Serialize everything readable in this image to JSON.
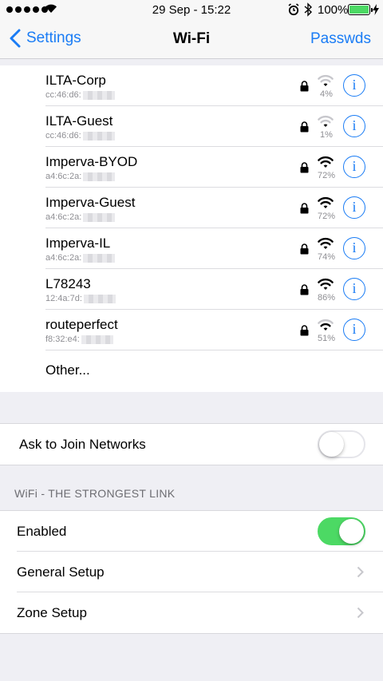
{
  "status_bar": {
    "time": "29 Sep - 15:22",
    "battery_percent": "100%",
    "battery_level": 1.0,
    "icons": [
      "signal-dots",
      "wifi-icon",
      "alarm-icon",
      "bluetooth-icon",
      "battery-icon",
      "charging-icon"
    ]
  },
  "nav": {
    "back_label": "Settings",
    "title": "Wi-Fi",
    "right_label": "Passwds"
  },
  "networks": [
    {
      "name": "ILTA-Corp",
      "mac": "cc:46:d6:",
      "signal": "4%",
      "bars": 1
    },
    {
      "name": "ILTA-Guest",
      "mac": "cc:46:d6:",
      "signal": "1%",
      "bars": 1
    },
    {
      "name": "Imperva-BYOD",
      "mac": "a4:6c:2a:",
      "signal": "72%",
      "bars": 3
    },
    {
      "name": "Imperva-Guest",
      "mac": "a4:6c:2a:",
      "signal": "72%",
      "bars": 3
    },
    {
      "name": "Imperva-IL",
      "mac": "a4:6c:2a:",
      "signal": "74%",
      "bars": 3
    },
    {
      "name": "L78243",
      "mac": "12:4a:7d:",
      "signal": "86%",
      "bars": 3
    },
    {
      "name": "routeperfect",
      "mac": "f8:32:e4:",
      "signal": "51%",
      "bars": 2
    }
  ],
  "other_label": "Other...",
  "ask_to_join": {
    "label": "Ask to Join Networks",
    "on": false
  },
  "section_header": "WiFi - THE STRONGEST LINK",
  "settings": {
    "enabled": {
      "label": "Enabled",
      "on": true
    },
    "general_setup": "General Setup",
    "zone_setup": "Zone Setup"
  },
  "colors": {
    "accent": "#1a7cf5",
    "toggle_on": "#4cd964",
    "background": "#efeff4",
    "secondary_text": "#8e8e93"
  }
}
